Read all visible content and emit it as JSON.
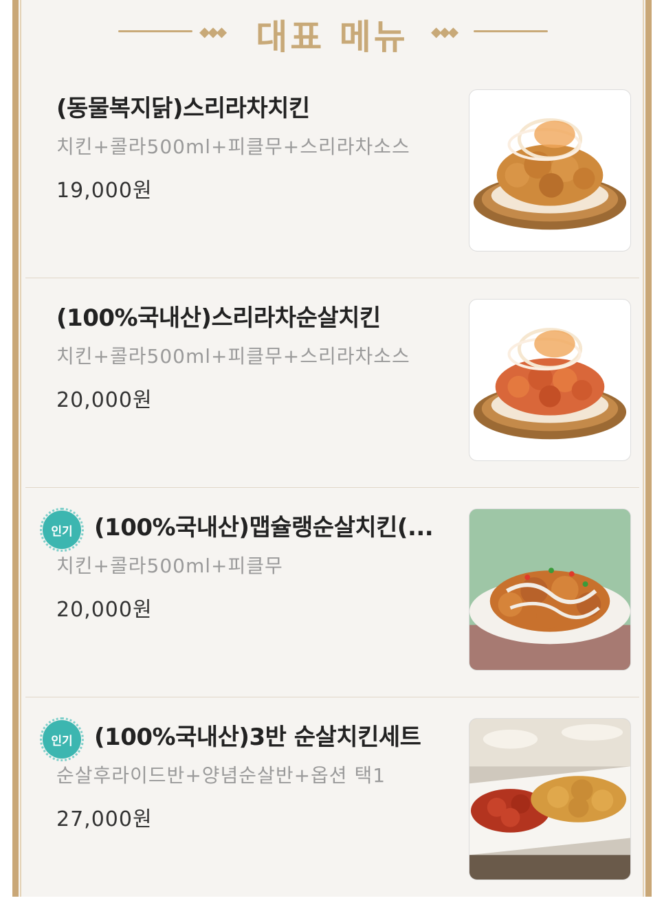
{
  "header": {
    "title": "대표 메뉴"
  },
  "menu": [
    {
      "name": "(동물복지닭)스리라차치킨",
      "desc": "치킨+콜라500ml+피클무+스리라차소스",
      "price": "19,000원",
      "badge": "",
      "image": "sriracha-chicken-photo"
    },
    {
      "name": "(100%국내산)스리라차순살치킨",
      "desc": "치킨+콜라500ml+피클무+스리라차소스",
      "price": "20,000원",
      "badge": "",
      "image": "sriracha-boneless-photo"
    },
    {
      "name": "(100%국내산)맵슐랭순살치킨(...",
      "desc": "치킨+콜라500ml+피클무",
      "price": "20,000원",
      "badge": "인기",
      "image": "mapsyullaeng-boneless-photo"
    },
    {
      "name": "(100%국내산)3반 순살치킨세트",
      "desc": "순살후라이드반+양념순살반+옵션 택1",
      "price": "27,000원",
      "badge": "인기",
      "image": "three-half-set-photo"
    }
  ]
}
